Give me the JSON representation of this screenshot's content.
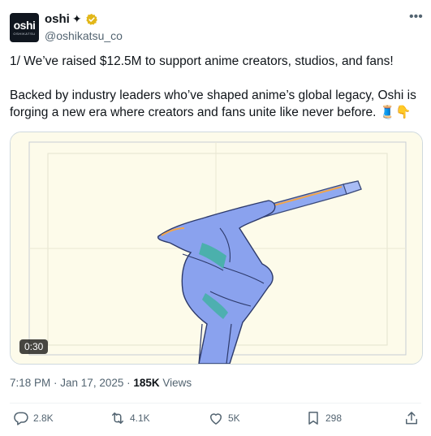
{
  "author": {
    "avatar_text": "oshi",
    "avatar_subtext": "OSHIKATSU",
    "display_name": "oshi",
    "name_glyph": "✦",
    "handle": "@oshikatsu_co"
  },
  "tweet": {
    "line1": "1/ We’ve raised $12.5M to support anime creators, studios, and fans!",
    "line2": "Backed by industry leaders who’ve shaped anime’s global legacy, Oshi is forging a new era where creators and fans unite like never before. 🧵👇"
  },
  "media": {
    "duration": "0:30"
  },
  "meta": {
    "time": "7:18 PM",
    "sep": " · ",
    "date": "Jan 17, 2025",
    "views_count": "185K",
    "views_label": " Views"
  },
  "actions": {
    "replies": "2.8K",
    "reposts": "4.1K",
    "likes": "5K",
    "bookmarks": "298"
  },
  "colors": {
    "verified_gold": "#e2b719",
    "muted": "#536471",
    "media_bg": "#fdfbea"
  },
  "icons": [
    "more-icon",
    "verified-badge-icon",
    "reply-icon",
    "repost-icon",
    "like-icon",
    "bookmark-icon",
    "share-icon"
  ]
}
